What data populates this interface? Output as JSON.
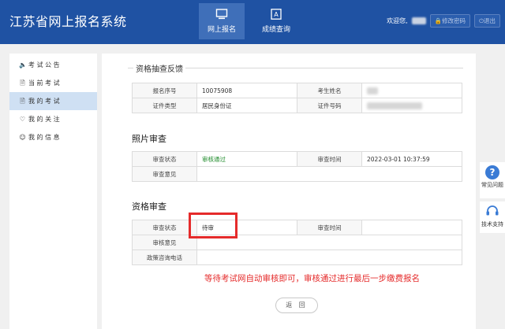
{
  "header": {
    "brand": "江苏省网上报名系统",
    "tabs": [
      {
        "label": "网上报名",
        "icon": "monitor-icon",
        "active": true
      },
      {
        "label": "成绩查询",
        "icon": "score-document-icon",
        "active": false
      }
    ],
    "welcome": "欢迎您,",
    "change_password": "修改密码",
    "logout": "退出"
  },
  "sidebar": {
    "items": [
      {
        "label": "考 试 公 告",
        "icon": "speaker-icon"
      },
      {
        "label": "当 前 考 试",
        "icon": "document-icon"
      },
      {
        "label": "我 的 考 试",
        "icon": "document-icon",
        "active": true
      },
      {
        "label": "我 的 关 注",
        "icon": "heart-icon"
      },
      {
        "label": "我 的 信 息",
        "icon": "user-icon"
      }
    ]
  },
  "main": {
    "section1": {
      "title": "资格抽查反馈",
      "rows": [
        {
          "l1": "报名序号",
          "v1": "10075908",
          "l2": "考生姓名",
          "v2": ""
        },
        {
          "l1": "证件类型",
          "v1": "居民身份证",
          "l2": "证件号码",
          "v2": ""
        }
      ]
    },
    "section2": {
      "title": "照片审查",
      "rows": [
        {
          "l1": "审查状态",
          "v1": "审核通过",
          "l2": "审查时间",
          "v2": "2022-03-01 10:37:59"
        },
        {
          "l1": "审查意见",
          "v1": ""
        }
      ]
    },
    "section3": {
      "title": "资格审查",
      "rows": [
        {
          "l1": "审查状态",
          "v1": "待审",
          "l2": "审查时间",
          "v2": ""
        },
        {
          "l1": "审核意见",
          "v1": ""
        },
        {
          "l1": "政策咨询电话",
          "v1": ""
        }
      ]
    },
    "note": "等待考试网自动审核即可，审核通过进行最后一步缴费报名",
    "back_button": "返 回"
  },
  "float_panel": {
    "faq": "常见问题",
    "support": "技术支持"
  },
  "colors": {
    "header_bg": "#1f52a3",
    "approved": "#1e8b2a",
    "annotation_red": "#e52b2b",
    "sidebar_active": "#cfe0f3"
  }
}
